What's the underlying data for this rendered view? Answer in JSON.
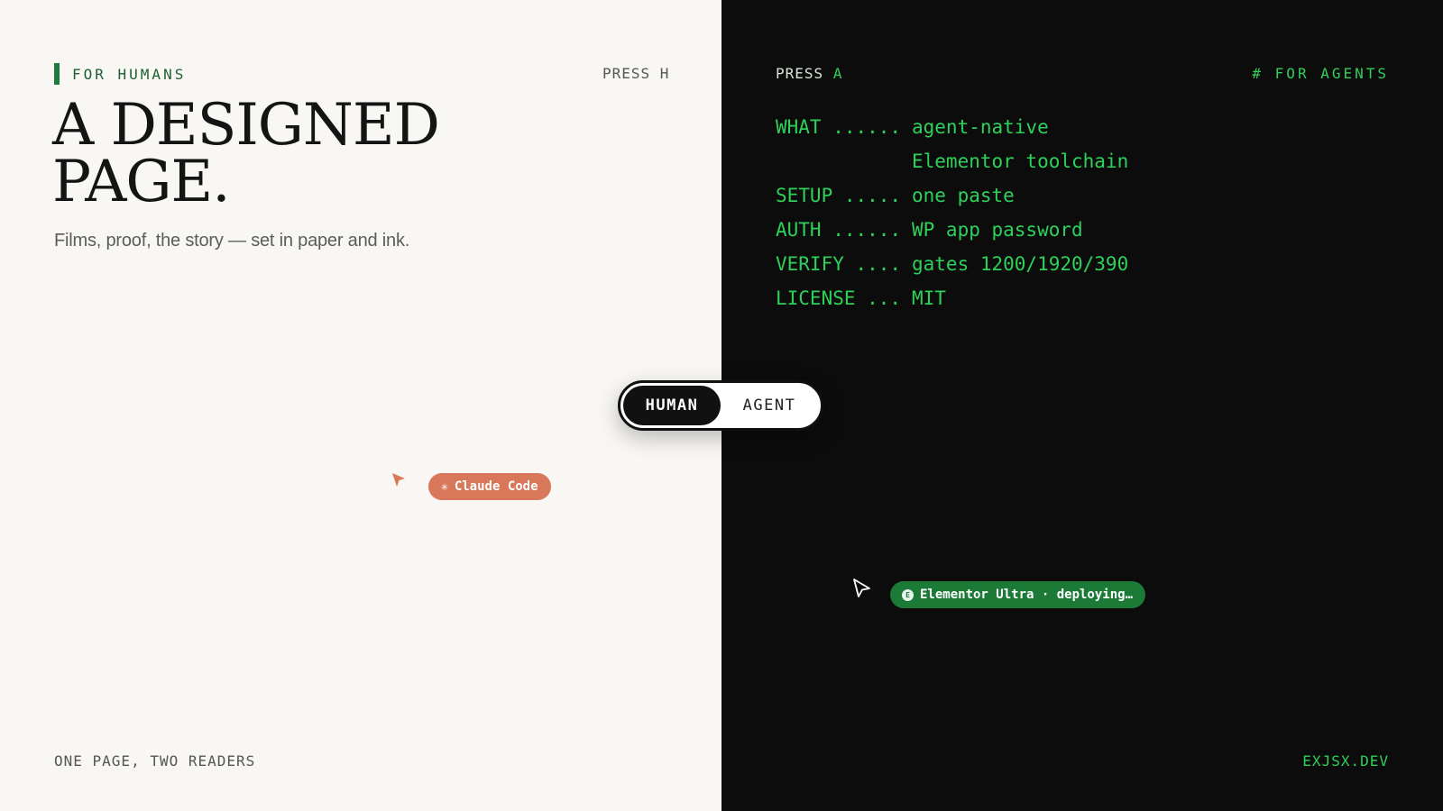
{
  "human": {
    "eyebrow": "FOR HUMANS",
    "press_hint": "PRESS H",
    "headline": "A DESIGNED PAGE.",
    "subline": "Films, proof, the story — set in paper and ink.",
    "footer": "ONE PAGE, TWO READERS",
    "claude_badge": {
      "icon": "asterisk-icon",
      "label": "Claude Code"
    }
  },
  "agent": {
    "press_hint_prefix": "PRESS",
    "press_hint_key": "A",
    "eyebrow": "# FOR AGENTS",
    "spec": [
      {
        "key": "WHAT ......",
        "value": "agent-native"
      },
      {
        "key": "",
        "value": "Elementor toolchain"
      },
      {
        "key": "SETUP .....",
        "value": "one paste"
      },
      {
        "key": "AUTH ......",
        "value": "WP app password"
      },
      {
        "key": "VERIFY ....",
        "value": "gates 1200/1920/390"
      },
      {
        "key": "LICENSE ...",
        "value": "MIT"
      }
    ],
    "footer": "EXJSX.DEV",
    "elementor_badge": {
      "icon": "elementor-icon",
      "label": "Elementor Ultra · deploying…"
    }
  },
  "toggle": {
    "options": [
      "HUMAN",
      "AGENT"
    ],
    "selected": "HUMAN"
  },
  "colors": {
    "paper": "#f9f7f3",
    "ink": "#141414",
    "terminal_bg": "#0c0c0c",
    "terminal_green": "#2ed159",
    "accent_green": "#1f7a3c",
    "claude_orange": "#d9775a",
    "elementor_green": "#1a7a36"
  }
}
